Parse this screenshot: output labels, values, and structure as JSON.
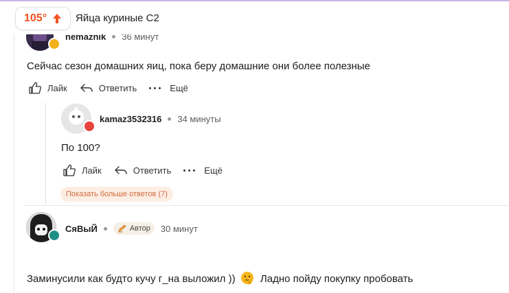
{
  "header": {
    "rating": "105°",
    "post_title": "Яйца куриные С2",
    "accent_color": "#f2531f"
  },
  "comments": [
    {
      "author": "nemaznik",
      "time": "36 минут",
      "text": "Сейчас сезон домашних яиц, пока беру домашние они более полезные",
      "actions": {
        "like": "Лайк",
        "reply": "Ответить",
        "more": "Ещё"
      }
    },
    {
      "author": "kamaz3532316",
      "time": "34 минуты",
      "text": "По 100?",
      "actions": {
        "like": "Лайк",
        "reply": "Ответить",
        "more": "Ещё"
      },
      "show_more_replies": "Показать больше ответов (7)"
    },
    {
      "author": "СяВыЙ",
      "author_badge": "Автор",
      "time": "30 минут",
      "text_before_emoji": "Заминусили как будто кучу г_на выложил ))",
      "text_after_emoji": "Ладно пойду покупку пробовать"
    }
  ]
}
